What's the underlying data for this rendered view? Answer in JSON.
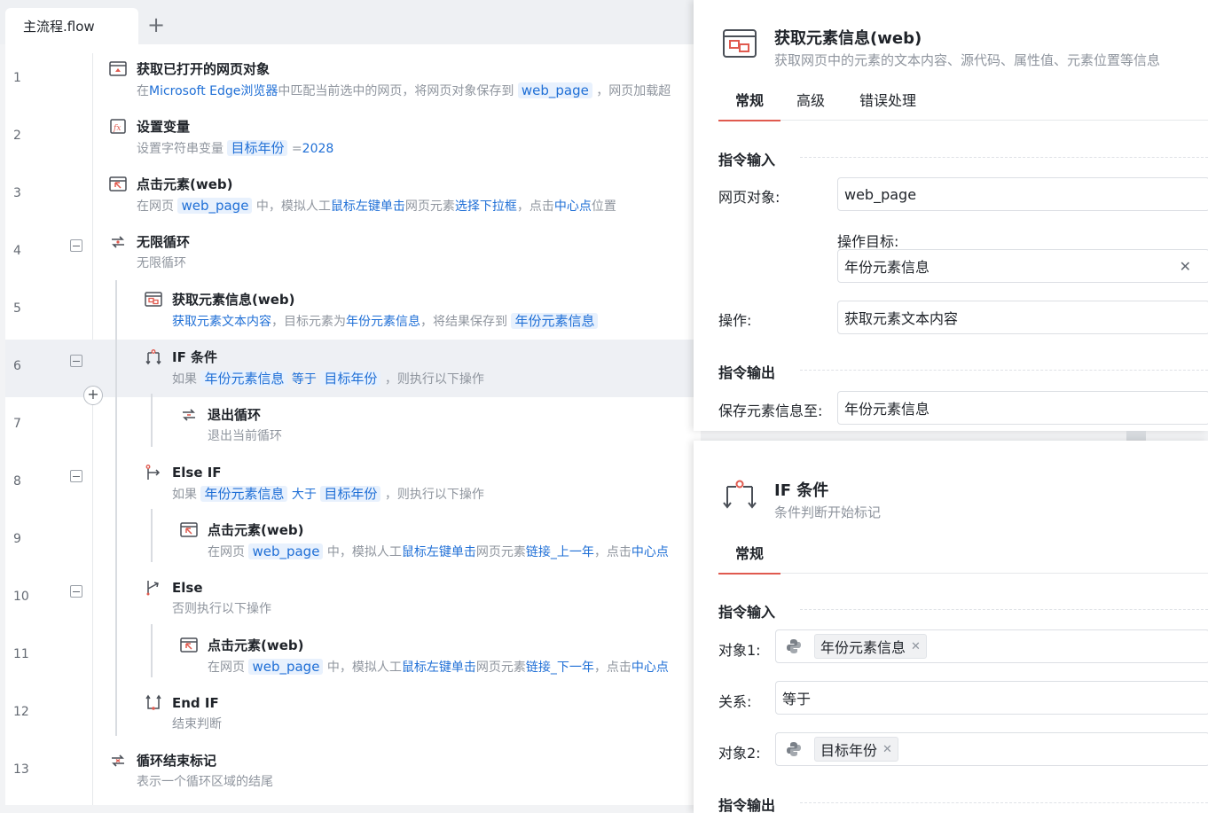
{
  "tabbar": {
    "active_tab": "主流程.flow",
    "add_label": "+"
  },
  "flow": {
    "rows": [
      {
        "n": "1",
        "title": "获取已打开的网页对象",
        "icon": "browser-page-icon",
        "desc": [
          {
            "t": "在"
          },
          {
            "t": "Microsoft Edge浏览器",
            "c": "b"
          },
          {
            "t": "中匹配当前选中的网页，将网页对象保存到 "
          },
          {
            "t": "web_page",
            "c": "chip"
          },
          {
            "t": " ，网页加载超"
          }
        ]
      },
      {
        "n": "2",
        "title": "设置变量",
        "icon": "variable-fx-icon",
        "desc": [
          {
            "t": "设置字符串变量 "
          },
          {
            "t": "目标年份",
            "c": "chip"
          },
          {
            "t": " ="
          },
          {
            "t": "2028",
            "c": "b"
          }
        ]
      },
      {
        "n": "3",
        "title": "点击元素(web)",
        "icon": "click-element-icon",
        "desc": [
          {
            "t": "在网页 "
          },
          {
            "t": "web_page",
            "c": "chip"
          },
          {
            "t": " 中，模拟人工"
          },
          {
            "t": "鼠标左键单击",
            "c": "b"
          },
          {
            "t": "网页元素"
          },
          {
            "t": "选择下拉框",
            "c": "b"
          },
          {
            "t": "，点击"
          },
          {
            "t": "中心点",
            "c": "b"
          },
          {
            "t": "位置"
          }
        ]
      },
      {
        "n": "4",
        "title": "无限循环",
        "icon": "loop-icon",
        "desc": [
          {
            "t": "无限循环"
          }
        ]
      },
      {
        "n": "5",
        "title": "获取元素信息(web)",
        "icon": "get-element-info-icon",
        "desc": [
          {
            "t": "获取元素文本内容",
            "c": "b"
          },
          {
            "t": "，目标元素为"
          },
          {
            "t": "年份元素信息",
            "c": "b"
          },
          {
            "t": "，将结果保存到 "
          },
          {
            "t": "年份元素信息",
            "c": "chip"
          }
        ]
      },
      {
        "n": "6",
        "title": "IF 条件",
        "icon": "if-condition-icon",
        "desc": [
          {
            "t": "如果 "
          },
          {
            "t": "年份元素信息",
            "c": "chip"
          },
          {
            "t": " "
          },
          {
            "t": "等于",
            "c": "b"
          },
          {
            "t": " "
          },
          {
            "t": "目标年份",
            "c": "chip"
          },
          {
            "t": " ，则执行以下操作"
          }
        ]
      },
      {
        "n": "7",
        "title": "退出循环",
        "icon": "exit-loop-icon",
        "desc": [
          {
            "t": "退出当前循环"
          }
        ]
      },
      {
        "n": "8",
        "title": "Else IF",
        "icon": "else-if-icon",
        "desc": [
          {
            "t": "如果 "
          },
          {
            "t": "年份元素信息",
            "c": "chip"
          },
          {
            "t": " "
          },
          {
            "t": "大于",
            "c": "b"
          },
          {
            "t": " "
          },
          {
            "t": "目标年份",
            "c": "chip"
          },
          {
            "t": " ，则执行以下操作"
          }
        ]
      },
      {
        "n": "9",
        "title": "点击元素(web)",
        "icon": "click-element-icon",
        "desc": [
          {
            "t": "在网页 "
          },
          {
            "t": "web_page",
            "c": "chip"
          },
          {
            "t": " 中，模拟人工"
          },
          {
            "t": "鼠标左键单击",
            "c": "b"
          },
          {
            "t": "网页元素"
          },
          {
            "t": "链接_上一年",
            "c": "b"
          },
          {
            "t": "，点击"
          },
          {
            "t": "中心点",
            "c": "b"
          }
        ]
      },
      {
        "n": "10",
        "title": "Else",
        "icon": "else-icon",
        "desc": [
          {
            "t": "否则执行以下操作"
          }
        ]
      },
      {
        "n": "11",
        "title": "点击元素(web)",
        "icon": "click-element-icon",
        "desc": [
          {
            "t": "在网页 "
          },
          {
            "t": "web_page",
            "c": "chip"
          },
          {
            "t": " 中，模拟人工"
          },
          {
            "t": "鼠标左键单击",
            "c": "b"
          },
          {
            "t": "网页元素"
          },
          {
            "t": "链接_下一年",
            "c": "b"
          },
          {
            "t": "，点击"
          },
          {
            "t": "中心点",
            "c": "b"
          }
        ]
      },
      {
        "n": "12",
        "title": "End IF",
        "icon": "end-if-icon",
        "desc": [
          {
            "t": "结束判断"
          }
        ]
      },
      {
        "n": "13",
        "title": "循环结束标记",
        "icon": "loop-end-icon",
        "desc": [
          {
            "t": "表示一个循环区域的结尾"
          }
        ]
      }
    ],
    "add_label": "+"
  },
  "panel1": {
    "title": "获取元素信息(web)",
    "subtitle": "获取网页中的元素的文本内容、源代码、属性值、元素位置等信息",
    "tabs": [
      "常规",
      "高级",
      "错误处理"
    ],
    "input_section": "指令输入",
    "web_page_label": "网页对象:",
    "web_page_value": "web_page",
    "target_label": "操作目标:",
    "target_value": "年份元素信息",
    "clear_symbol": "✕",
    "op_label": "操作:",
    "op_value": "获取元素文本内容",
    "output_section": "指令输出",
    "save_label": "保存元素信息至:",
    "save_value": "年份元素信息"
  },
  "panel2": {
    "title": "IF 条件",
    "subtitle": "条件判断开始标记",
    "tabs": [
      "常规"
    ],
    "input_section": "指令输入",
    "obj1_label": "对象1:",
    "obj1_value": "年份元素信息",
    "relation_label": "关系:",
    "relation_value": "等于",
    "obj2_label": "对象2:",
    "obj2_value": "目标年份",
    "tag_remove": "✕",
    "output_section": "指令输出"
  },
  "colors": {
    "accent": "#e05a4f",
    "link": "#1f6fd6",
    "chip_bg": "#e8f1fd",
    "selected_row": "#eef0f4"
  }
}
